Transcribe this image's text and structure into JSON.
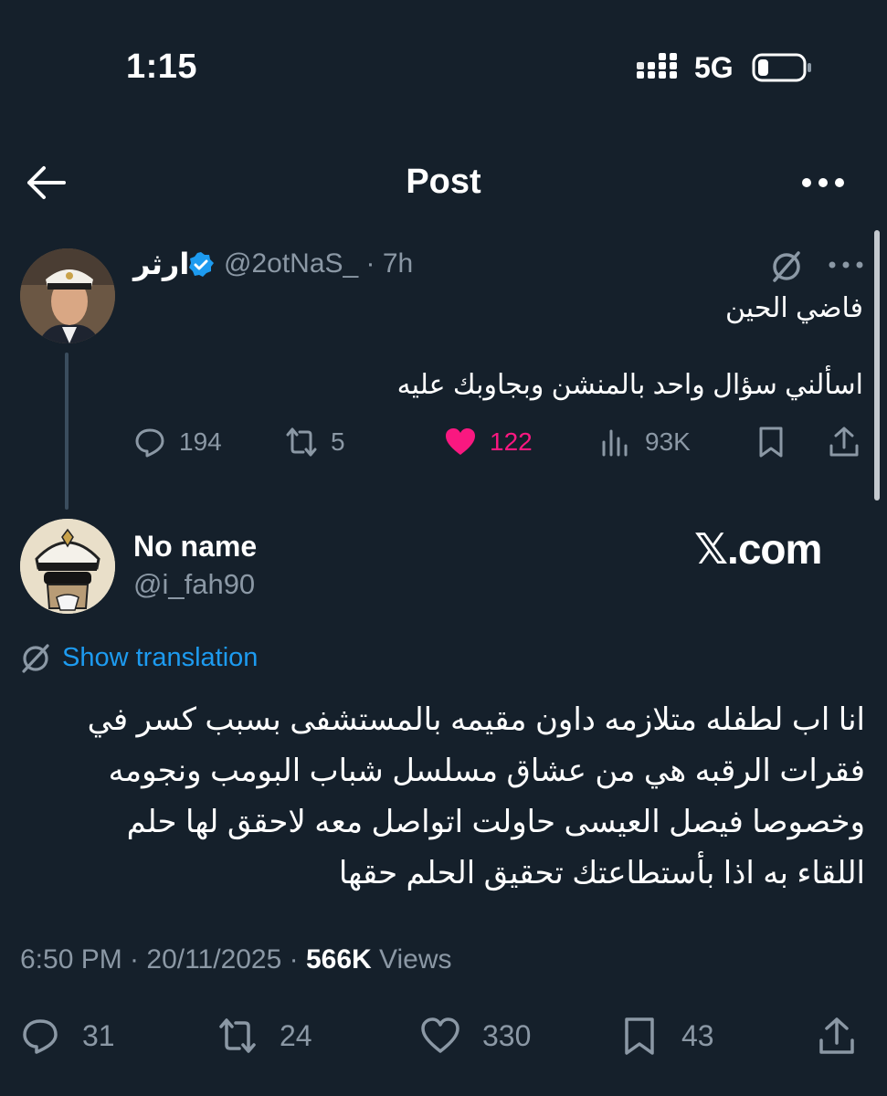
{
  "status_bar": {
    "time": "1:15",
    "network": "5G"
  },
  "header": {
    "title": "Post"
  },
  "parent_tweet": {
    "author_name": "ارثر",
    "handle_time": "@2otNaS_ · 7h",
    "text_line1": "فاضي الحين",
    "text_line2": "اسألني سؤال واحد بالمنشن وبجاوبك عليه",
    "stats": {
      "replies": "194",
      "reposts": "5",
      "likes": "122",
      "views": "93K"
    }
  },
  "main_tweet": {
    "author_name": "No name",
    "handle": "@i_fah90",
    "watermark": "𝕏.com",
    "translate_label": "Show translation",
    "body_lines": [
      "انا اب لطفله متلازمه داون مقيمه بالمستشفى بسبب كسر في",
      "فقرات الرقبه هي من عشاق مسلسل شباب البومب ونجومه",
      "وخصوصا فيصل العيسى حاولت اتواصل معه لاحقق لها حلم",
      "اللقاء به اذا بأستطاعتك تحقيق الحلم حقها"
    ],
    "meta_time": "6:50 PM · 20/11/2025 · ",
    "meta_views": "566K",
    "meta_views_label": " Views",
    "stats": {
      "replies": "31",
      "reposts": "24",
      "likes": "330",
      "bookmarks": "43"
    }
  },
  "colors": {
    "background": "#15202b",
    "secondary_text": "#8b98a5",
    "link": "#1d9bf0",
    "like": "#f91880",
    "verified": "#1d9bf0"
  }
}
